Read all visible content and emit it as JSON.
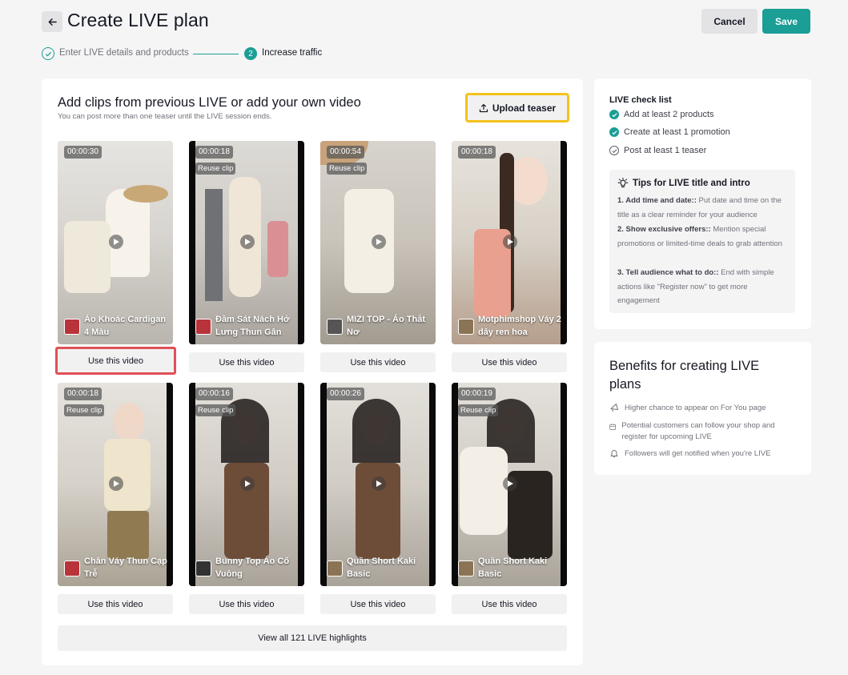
{
  "header": {
    "title": "Create LIVE plan",
    "cancel_label": "Cancel",
    "save_label": "Save"
  },
  "stepper": {
    "step1_label": "Enter LIVE details and products",
    "step2_number": "2",
    "step2_label": "Increase traffic"
  },
  "main": {
    "title": "Add clips from previous LIVE or add your own video",
    "subtitle": "You can post more than one teaser until the LIVE session ends.",
    "upload_label": "Upload teaser",
    "use_video_label": "Use this video",
    "view_all_label": "View all 121 LIVE highlights",
    "reuse_label": "Reuse clip",
    "videos": [
      {
        "duration": "00:00:30",
        "title": "Áo Khoác Cardigan 4 Màu"
      },
      {
        "duration": "00:00:18",
        "title": "Đầm Sát Nách Hở Lưng Thun Gân"
      },
      {
        "duration": "00:00:54",
        "title": "MIZI TOP - Áo Thắt Nơ"
      },
      {
        "duration": "00:00:18",
        "title": "Motphimshop Váy 2 dây ren hoa"
      },
      {
        "duration": "00:00:18",
        "title": "Chân Váy Thun Cạp Trễ"
      },
      {
        "duration": "00:00:16",
        "title": "Bunny Top Áo Cổ Vuông"
      },
      {
        "duration": "00:00:26",
        "title": "Quần Short Kaki Basic"
      },
      {
        "duration": "00:00:19",
        "title": "Quần Short Kaki Basic"
      }
    ]
  },
  "checklist": {
    "title": "LIVE check list",
    "items": [
      {
        "label": "Add at least 2 products",
        "done": true
      },
      {
        "label": "Create at least 1 promotion",
        "done": true
      },
      {
        "label": "Post at least 1 teaser",
        "done": false
      }
    ],
    "tips_title": "Tips for LIVE title and intro",
    "tips": [
      {
        "head": "1. Add time and date::",
        "body": " Put date and time on the title as a clear reminder for your audience"
      },
      {
        "head": "2. Show exclusive offers::",
        "body": " Mention special promotions or limited-time deals to grab attention"
      },
      {
        "head": "3. Tell audience what to do::",
        "body": " End with simple actions like \"Register now\" to get more engagement"
      }
    ]
  },
  "benefits": {
    "title": "Benefits for creating LIVE plans",
    "items": [
      {
        "label": "Higher chance to appear on For You page",
        "icon": "megaphone-icon"
      },
      {
        "label": "Potential customers can follow your shop and register for upcoming LIVE",
        "icon": "calendar-icon"
      },
      {
        "label": "Followers will get notified when you're LIVE",
        "icon": "bell-icon"
      }
    ]
  },
  "colors": {
    "accent": "#1a9e96",
    "highlight_yellow": "#f4c21b",
    "highlight_red": "#e05057"
  }
}
